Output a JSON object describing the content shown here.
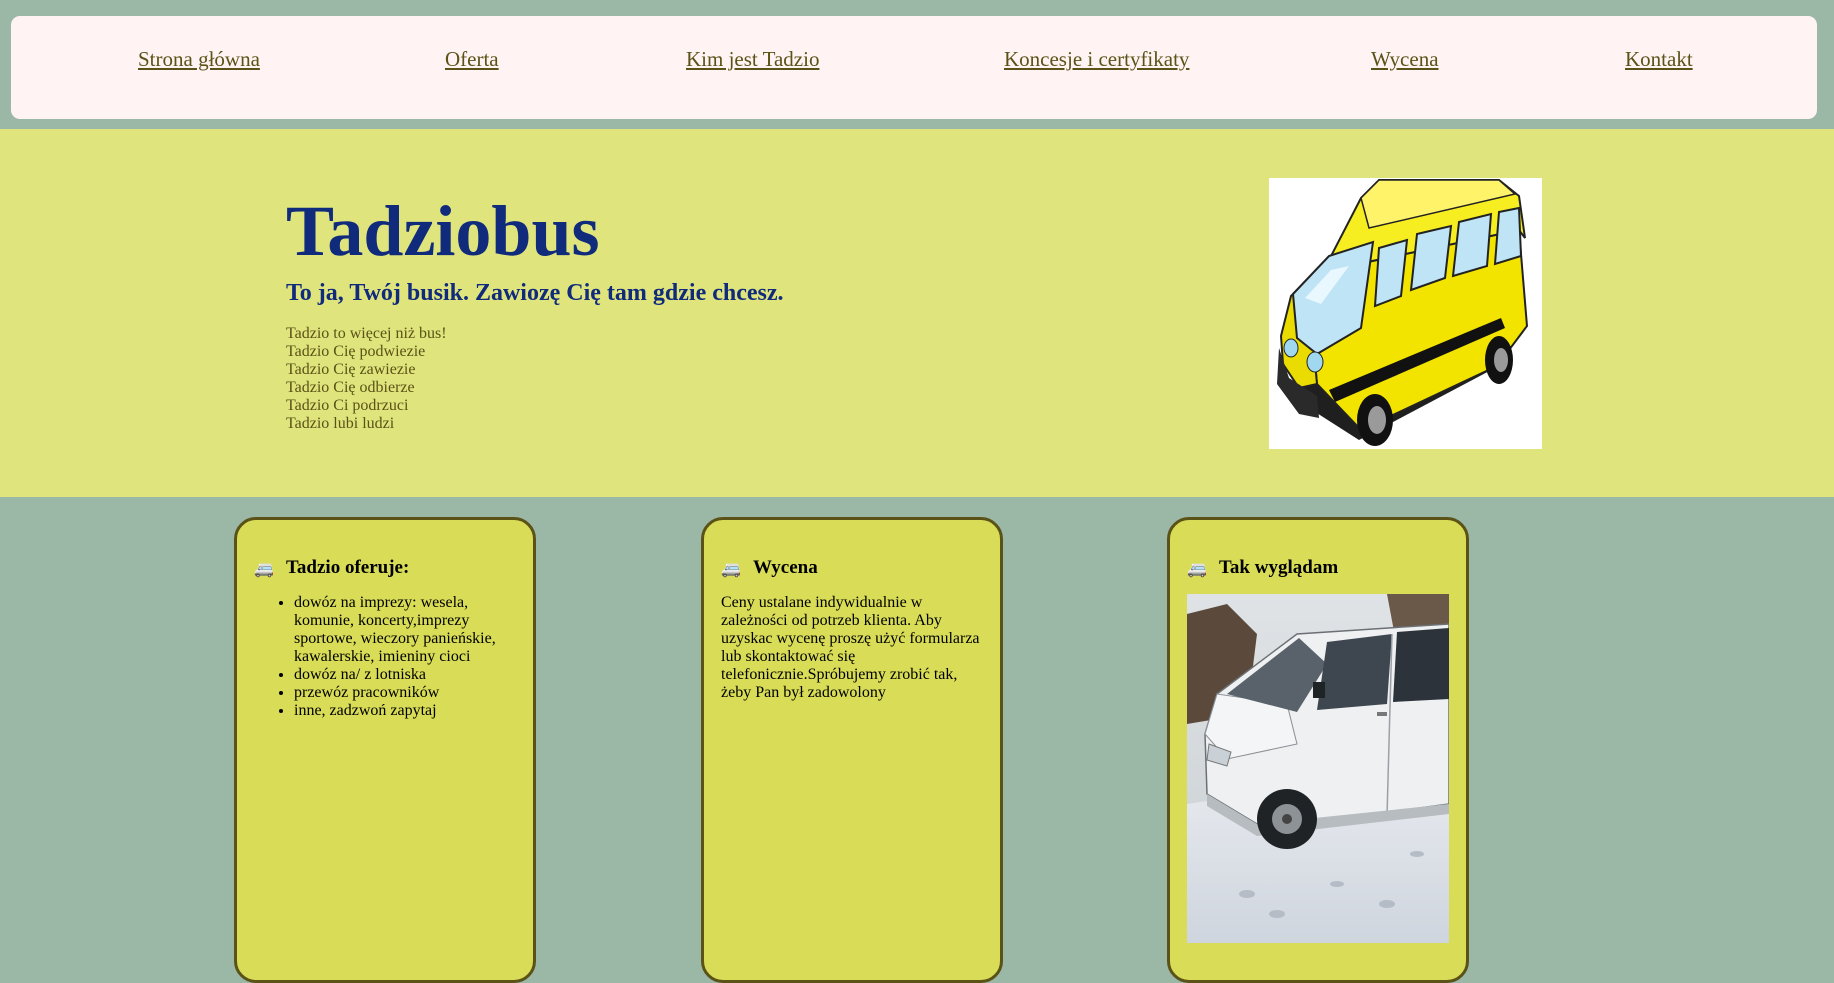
{
  "nav": {
    "items": [
      {
        "label": "Strona główna"
      },
      {
        "label": "Oferta"
      },
      {
        "label": "Kim jest Tadzio"
      },
      {
        "label": "Koncesje i certyfikaty"
      },
      {
        "label": "Wycena"
      },
      {
        "label": "Kontakt"
      }
    ]
  },
  "hero": {
    "title": "Tadziobus",
    "subtitle": "To ja, Twój busik. Zawiozę Cię tam gdzie chcesz.",
    "lines": [
      "Tadzio to więcej niż bus!",
      "Tadzio Cię podwiezie",
      "Tadzio Cię zawiezie",
      "Tadzio Cię odbierze",
      "Tadzio Ci podrzuci",
      "Tadzio lubi ludzi"
    ],
    "image_icon": "yellow-minibus-illustration"
  },
  "cards": [
    {
      "icon": "🚐",
      "title": "Tadzio oferuje:",
      "items": [
        "dowóz na imprezy: wesela, komunie, koncerty,imprezy sportowe, wieczory panieńskie, kawalerskie, imieniny cioci",
        "dowóz na/ z lotniska",
        "przewóz pracowników",
        "inne, zadzwoń zapytaj"
      ]
    },
    {
      "icon": "🚐",
      "title": "Wycena",
      "text": "Ceny ustalane indywidualnie w zależności od potrzeb klienta. Aby uzyskac wycenę proszę użyć formularza lub skontaktować się telefonicznie.Spróbujemy zrobić tak, żeby Pan był zadowolony"
    },
    {
      "icon": "🚐",
      "title": "Tak wyglądam",
      "image_icon": "white-van-in-snow-photo"
    }
  ],
  "colors": {
    "page_bg": "#9bb7a6",
    "nav_bg": "#fff4f3",
    "hero_bg": "#dfe57c",
    "card_bg": "#d8dc56",
    "heading": "#102a7c",
    "link": "#5a5217"
  }
}
